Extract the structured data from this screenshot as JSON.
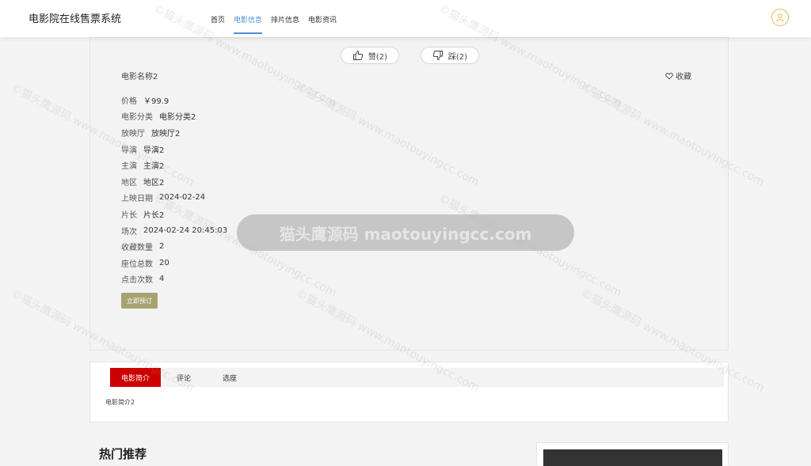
{
  "header": {
    "site_title": "电影院在线售票系统",
    "nav": [
      "首页",
      "电影信息",
      "排片信息",
      "电影资讯"
    ],
    "active_nav": "电影信息"
  },
  "votes": {
    "like_label": "赞(2)",
    "dislike_label": "踩(2)"
  },
  "movie": {
    "name": "电影名称2",
    "favorite_label": "收藏",
    "fields": [
      {
        "label": "价格",
        "value": "￥99.9"
      },
      {
        "label": "电影分类",
        "value": "电影分类2"
      },
      {
        "label": "放映厅",
        "value": "放映厅2"
      },
      {
        "label": "导演",
        "value": "导演2"
      },
      {
        "label": "主演",
        "value": "主演2"
      },
      {
        "label": "地区",
        "value": "地区2"
      },
      {
        "label": "上映日期",
        "value": "2024-02-24"
      },
      {
        "label": "片长",
        "value": "片长2"
      },
      {
        "label": "场次",
        "value": "2024-02-24 20:45:03"
      },
      {
        "label": "收藏数量",
        "value": "2"
      },
      {
        "label": "座位总数",
        "value": "20"
      },
      {
        "label": "点击次数",
        "value": "4"
      }
    ],
    "book_label": "立即预订"
  },
  "tabs": {
    "items": [
      "电影简介",
      "评论",
      "选座"
    ],
    "active": "电影简介",
    "content": "电影简介2"
  },
  "bottom": {
    "hot_title": "热门推荐"
  },
  "watermark": {
    "banner": "猫头鹰源码 maotouyingcc.com",
    "tile_text": "©猫头鹰源码 www.maotouyingcc.com"
  },
  "colors": {
    "accent_blue": "#4a90d9",
    "tab_active_red": "#cc0000",
    "book_button": "#a8a272",
    "avatar_ring": "#e8b54a"
  }
}
